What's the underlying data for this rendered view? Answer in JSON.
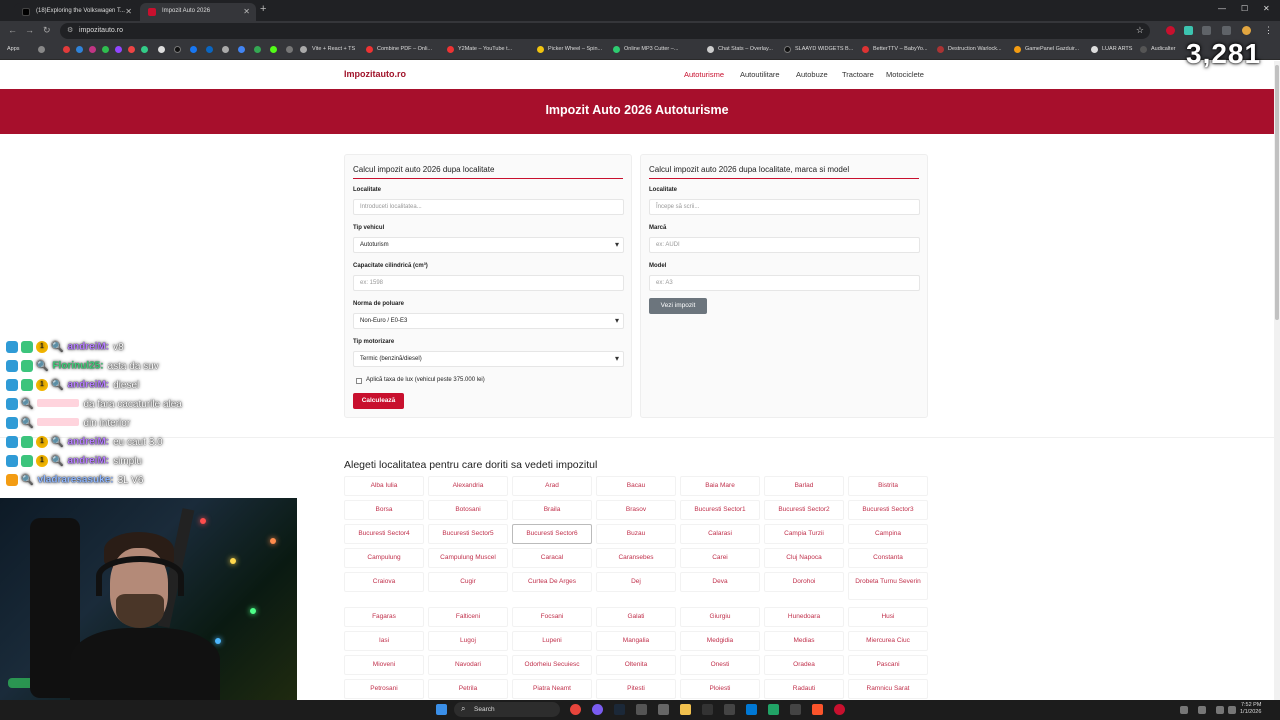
{
  "browser": {
    "tabs": [
      {
        "title": "(18)Exploring the Volkswagen T...",
        "active": false
      },
      {
        "title": "Impozit Auto 2026",
        "active": true
      }
    ],
    "url": "impozitauto.ro",
    "bookmarks": [
      "Apps",
      "Vite + React + TS",
      "Combine PDF – Onli...",
      "Y2Mate – YouTube t...",
      "Picker Wheel – Spin...",
      "Online MP3 Cutter –...",
      "Chat Stats – Overlay...",
      "SLAAYD WIDGETS B...",
      "BetterTTV – BabyYo...",
      "Destruction Warlock...",
      "GamePanel Gazduir...",
      "LUAR ARTS",
      "Audicalter"
    ]
  },
  "site": {
    "brand": "Impozitauto.ro",
    "nav": [
      "Autoturisme",
      "Autoutilitare",
      "Autobuze",
      "Tractoare",
      "Motociclete"
    ],
    "hero_title": "Impozit Auto 2026 Autoturisme",
    "card_left": {
      "title": "Calcul impozit auto 2026 dupa localitate",
      "localitate_label": "Localitate",
      "localitate_placeholder": "Introduceti localitatea...",
      "tip_label": "Tip vehicul",
      "tip_value": "Autoturism",
      "capacitate_label": "Capacitate cilindrică (cm³)",
      "capacitate_placeholder": "ex: 1598",
      "norma_label": "Norma de poluare",
      "norma_value": "Non-Euro / E0-E3",
      "motor_label": "Tip motorizare",
      "motor_value": "Termic (benzină/diesel)",
      "lux_label": "Aplică taxa de lux (vehicul peste 375.000 lei)",
      "button": "Calculează"
    },
    "card_right": {
      "title": "Calcul impozit auto 2026 dupa localitate, marca si model",
      "localitate_label": "Localitate",
      "localitate_placeholder": "Începe să scrii...",
      "marca_label": "Marcă",
      "marca_placeholder": "ex: AUDI",
      "model_label": "Model",
      "model_placeholder": "ex: A3",
      "button": "Vezi impozit"
    },
    "localities_title": "Alegeti localitatea pentru care doriti sa vedeti impozitul",
    "localities": [
      "Alba Iulia",
      "Alexandria",
      "Arad",
      "Bacau",
      "Baia Mare",
      "Barlad",
      "Bistrita",
      "Borsa",
      "Botosani",
      "Braila",
      "Brasov",
      "Bucuresti Sector1",
      "Bucuresti Sector2",
      "Bucuresti Sector3",
      "Bucuresti Sector4",
      "Bucuresti Sector5",
      "Bucuresti Sector6",
      "Buzau",
      "Calarasi",
      "Campia Turzii",
      "Campina",
      "Campulung",
      "Campulung Muscel",
      "Caracal",
      "Caransebes",
      "Carei",
      "Cluj Napoca",
      "Constanta",
      "Craiova",
      "Cugir",
      "Curtea De Arges",
      "Dej",
      "Deva",
      "Dorohoi",
      "Drobeta Turnu Severin",
      "Fagaras",
      "Falticeni",
      "Focsani",
      "Galati",
      "Giurgiu",
      "Hunedoara",
      "Husi",
      "Iasi",
      "Lugoj",
      "Lupeni",
      "Mangalia",
      "Medgidia",
      "Medias",
      "Miercurea Ciuc",
      "Mioveni",
      "Navodari",
      "Odorheiu Secuiesc",
      "Oltenita",
      "Onesti",
      "Oradea",
      "Pascani",
      "Petrosani",
      "Petrila",
      "Piatra Neamt",
      "Pitesti",
      "Ploiesti",
      "Radauti",
      "Ramnicu Sarat"
    ]
  },
  "overlay": {
    "viewer_count": "3,281",
    "chat": [
      {
        "user": "andreiM:",
        "msg": "v8",
        "color": "#b57cff",
        "badges": [
          "blue",
          "green",
          "gold"
        ]
      },
      {
        "user": "Florinul25:",
        "msg": "asta da suv",
        "color": "#3fd17a",
        "badges": [
          "blue",
          "green"
        ]
      },
      {
        "user": "andreiM:",
        "msg": "diesel",
        "color": "#b57cff",
        "badges": [
          "blue",
          "green",
          "gold"
        ]
      },
      {
        "user": "",
        "msg": "da fara cacaturile alea",
        "color": "#ff9fb3",
        "badges": [
          "blue"
        ]
      },
      {
        "user": "",
        "msg": "din interior",
        "color": "#ff9fb3",
        "badges": [
          "blue"
        ]
      },
      {
        "user": "andreiM:",
        "msg": "eu caut 3.0",
        "color": "#b57cff",
        "badges": [
          "blue",
          "green",
          "gold"
        ]
      },
      {
        "user": "andreiM:",
        "msg": "simplu",
        "color": "#b57cff",
        "badges": [
          "blue",
          "green",
          "gold"
        ]
      },
      {
        "user": "vladraresasuke:",
        "msg": "3L V6",
        "color": "#8fb7ff",
        "badges": [
          "orange"
        ]
      }
    ]
  },
  "taskbar": {
    "search": "Search",
    "time": "7:52 PM",
    "date": "1/1/2026"
  }
}
